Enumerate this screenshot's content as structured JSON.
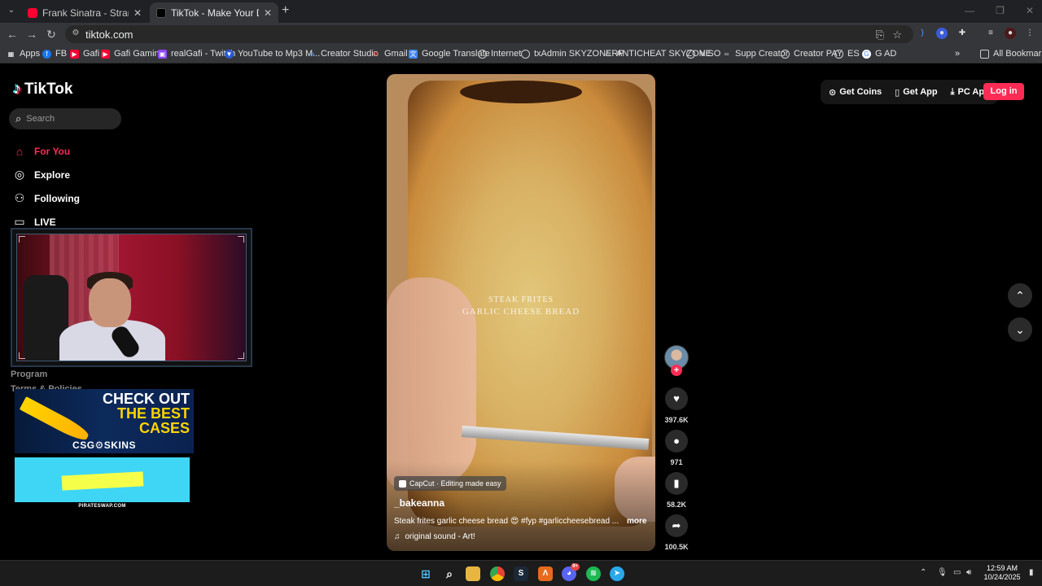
{
  "browser": {
    "tabs": [
      {
        "title": "Frank Sinatra - Strangers In The Night",
        "active": false,
        "icon": "youtube-icon"
      },
      {
        "title": "TikTok - Make Your Day",
        "active": true,
        "icon": "tiktok-icon"
      }
    ],
    "url": "tiktok.com",
    "bookmarks": [
      {
        "label": "Apps"
      },
      {
        "label": "FB"
      },
      {
        "label": "Gafi"
      },
      {
        "label": "Gafi Gaming"
      },
      {
        "label": "realGafi - Twitch"
      },
      {
        "label": "YouTube to Mp3 M..."
      },
      {
        "label": "Creator Studio"
      },
      {
        "label": "Gmail"
      },
      {
        "label": "Google Translate"
      },
      {
        "label": "Internet"
      },
      {
        "label": "txAdmin SKYZONERP"
      },
      {
        "label": "ANTICHEAT SKYZONE"
      },
      {
        "label": "VISO"
      },
      {
        "label": "Supp Creator"
      },
      {
        "label": "Creator PAY"
      },
      {
        "label": "ES"
      },
      {
        "label": "G AD"
      }
    ],
    "more_bookmarks": "»",
    "all_bookmarks": "All Bookmarks"
  },
  "tiktok": {
    "logo": "TikTok",
    "search_placeholder": "Search",
    "nav": [
      {
        "label": "For You",
        "icon": "home-icon"
      },
      {
        "label": "Explore",
        "icon": "compass-icon"
      },
      {
        "label": "Following",
        "icon": "following-icon"
      },
      {
        "label": "LIVE",
        "icon": "live-tv-icon"
      }
    ],
    "footer": {
      "program": "Program",
      "terms": "Terms & Policies"
    },
    "top_actions": {
      "get_coins": "Get Coins",
      "get_app": "Get App",
      "pc_app": "PC App",
      "login": "Log in"
    }
  },
  "overlays": {
    "ad1": {
      "line1": "CHECK OUT",
      "line2": "THE BEST",
      "line3": "CASES",
      "brand": "CSG⚙SKINS"
    },
    "ad2": {
      "footer": "PIRATESWAP.COM"
    }
  },
  "video": {
    "overlay_text_1": "STEAK FRITES",
    "overlay_text_2": "GARLIC CHEESE BREAD",
    "capcut": "CapCut · Editing made easy",
    "author": "_bakeanna",
    "caption": "Steak frites garlic cheese bread 😍 #fyp #garliccheesebread ...",
    "more": "more",
    "sound": "original sound - Art!",
    "likes": "397.6K",
    "comments": "971",
    "saves": "58.2K",
    "shares": "100.5K"
  },
  "taskbar": {
    "time": "12:59 AM",
    "date": "10/24/2025",
    "discord_badge": "9+"
  }
}
